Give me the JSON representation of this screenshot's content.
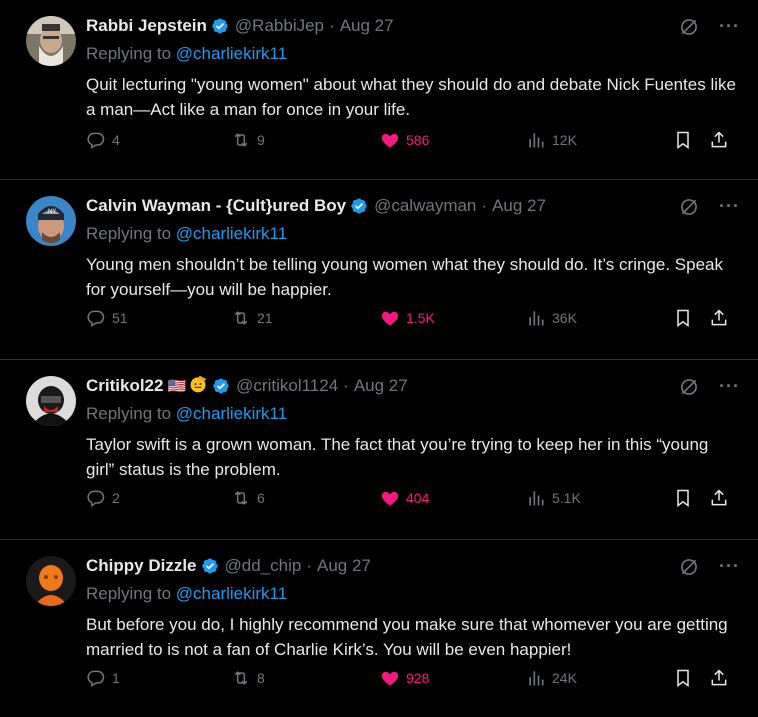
{
  "tweets": [
    {
      "name": "Rabbi Jepstein",
      "handle": "@RabbiJep",
      "date": "Aug 27",
      "replying_prefix": "Replying to ",
      "replying_to": "@charliekirk11",
      "text": "Quit lecturing \"young women\" about what they should do and debate Nick Fuentes like a man—Act like a man for once in your life.",
      "replies": "4",
      "reposts": "9",
      "likes": "586",
      "views": "12K"
    },
    {
      "name": "Calvin Wayman - {Cult}ured Boy",
      "handle": "@calwayman",
      "date": "Aug 27",
      "replying_prefix": "Replying to ",
      "replying_to": "@charliekirk11",
      "text": "Young men shouldn’t be telling young women what they should do. It’s cringe. Speak for yourself—you will be happier.",
      "replies": "51",
      "reposts": "21",
      "likes": "1.5K",
      "views": "36K"
    },
    {
      "name": "Critikol22",
      "flag": "🇺🇸",
      "handle": "@critikol1124",
      "date": "Aug 27",
      "replying_prefix": "Replying to ",
      "replying_to": "@charliekirk11",
      "text": "Taylor swift is a grown woman. The fact that you’re trying to keep her in this “young girl” status is the problem.",
      "replies": "2",
      "reposts": "6",
      "likes": "404",
      "views": "5.1K"
    },
    {
      "name": "Chippy Dizzle",
      "handle": "@dd_chip",
      "date": "Aug 27",
      "replying_prefix": "Replying to ",
      "replying_to": "@charliekirk11",
      "text": "But before you do, I highly recommend you make sure that whomever you are getting married to is not a fan of Charlie Kirk’s. You will be even happier!",
      "replies": "1",
      "reposts": "8",
      "likes": "928",
      "views": "24K"
    }
  ],
  "separator": "·",
  "more_glyph": "···",
  "colors": {
    "accent": "#1d9bf0",
    "like": "#f91880",
    "muted": "#71767b",
    "text": "#e7e9ea",
    "border": "#2f3336"
  },
  "icons": [
    "verified-badge-icon",
    "grok-icon",
    "more-icon",
    "reply-icon",
    "repost-icon",
    "heart-icon",
    "views-icon",
    "bookmark-icon",
    "share-icon"
  ]
}
